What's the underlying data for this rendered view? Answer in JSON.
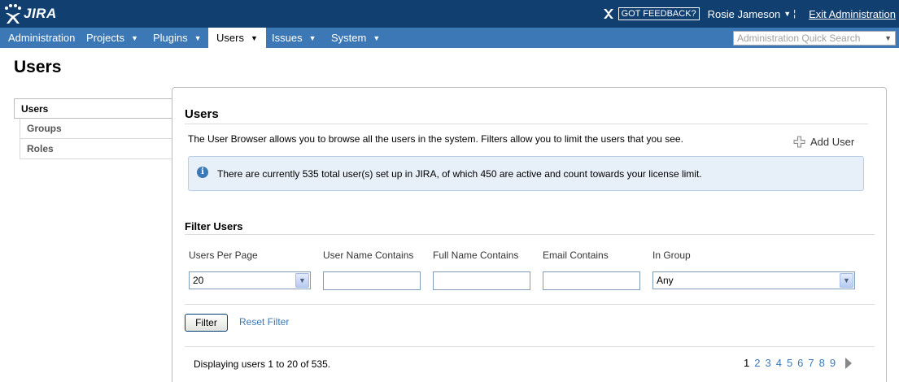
{
  "header": {
    "logo_text": "JIRA",
    "feedback_label": "GOT FEEDBACK?",
    "user_name": "Rosie Jameson",
    "exit_label": "Exit Administration"
  },
  "nav": {
    "items": [
      {
        "label": "Administration",
        "has_dropdown": false
      },
      {
        "label": "Projects",
        "has_dropdown": true
      },
      {
        "label": "Plugins",
        "has_dropdown": true
      },
      {
        "label": "Users",
        "has_dropdown": true,
        "active": true
      },
      {
        "label": "Issues",
        "has_dropdown": true
      },
      {
        "label": "System",
        "has_dropdown": true
      }
    ],
    "quick_search_placeholder": "Administration Quick Search"
  },
  "page_title": "Users",
  "sidebar": {
    "items": [
      {
        "label": "Users",
        "active": true
      },
      {
        "label": "Groups"
      },
      {
        "label": "Roles"
      }
    ]
  },
  "main": {
    "title": "Users",
    "description": "The User Browser allows you to browse all the users in the system. Filters allow you to limit the users that you see.",
    "add_user_label": "Add User",
    "info_message": "There are currently 535 total user(s) set up in JIRA, of which 450 are active and count towards your license limit.",
    "filter": {
      "title": "Filter Users",
      "users_per_page_label": "Users Per Page",
      "users_per_page_value": "20",
      "username_label": "User Name Contains",
      "username_value": "",
      "fullname_label": "Full Name Contains",
      "fullname_value": "",
      "email_label": "Email Contains",
      "email_value": "",
      "group_label": "In Group",
      "group_value": "Any",
      "filter_button": "Filter",
      "reset_label": "Reset Filter"
    },
    "displaying_text": "Displaying users 1 to 20 of 535.",
    "pages": [
      "1",
      "2",
      "3",
      "4",
      "5",
      "6",
      "7",
      "8",
      "9"
    ],
    "current_page": "1"
  },
  "colors": {
    "header_bg": "#114070",
    "nav_bg": "#3c78b5",
    "link": "#3c78b5",
    "info_bg": "#e7eff8"
  }
}
